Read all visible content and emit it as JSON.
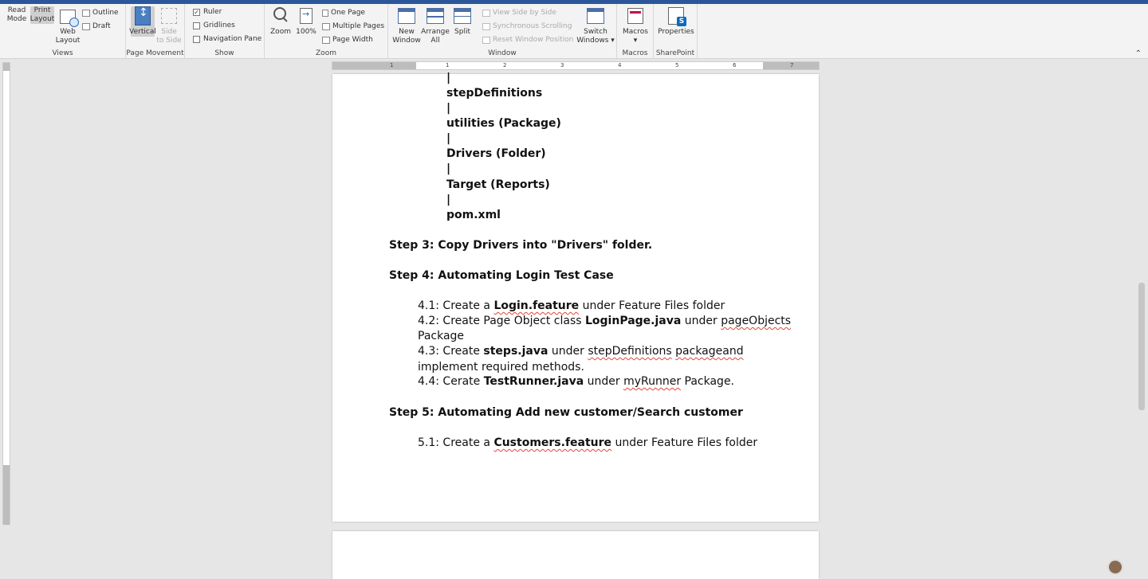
{
  "ribbon": {
    "views": {
      "label": "Views",
      "read_mode": "Read\nMode",
      "print_layout": "Print\nLayout",
      "web_layout": "Web\nLayout",
      "outline": "Outline",
      "draft": "Draft"
    },
    "page_movement": {
      "label": "Page Movement",
      "vertical": "Vertical",
      "side_to_side": "Side\nto Side"
    },
    "show": {
      "label": "Show",
      "ruler": "Ruler",
      "gridlines": "Gridlines",
      "navigation_pane": "Navigation Pane"
    },
    "zoom": {
      "label": "Zoom",
      "zoom": "Zoom",
      "hundred": "100%",
      "one_page": "One Page",
      "multiple_pages": "Multiple Pages",
      "page_width": "Page Width"
    },
    "window": {
      "label": "Window",
      "new_window": "New\nWindow",
      "arrange_all": "Arrange\nAll",
      "split": "Split",
      "view_side_by_side": "View Side by Side",
      "synchronous_scrolling": "Synchronous Scrolling",
      "reset_window_position": "Reset Window Position",
      "switch_windows": "Switch\nWindows ▾"
    },
    "macros": {
      "label": "Macros",
      "macros": "Macros\n▾"
    },
    "sharepoint": {
      "label": "SharePoint",
      "properties": "Properties"
    }
  },
  "ruler_ticks": [
    "1",
    "1",
    "2",
    "3",
    "4",
    "5",
    "6",
    "7"
  ],
  "document": {
    "tree": [
      "|",
      "stepDefinitions",
      "|",
      "utilities (Package)",
      "|",
      "Drivers (Folder)",
      "|",
      "Target (Reports)",
      "|",
      "pom.xml"
    ],
    "step3": "Step 3: Copy Drivers into \"Drivers\" folder.",
    "step4": "Step 4: Automating Login Test Case",
    "s41": {
      "a": "4.1: Create a ",
      "b": "Login.feature",
      "c": " under Feature Files folder"
    },
    "s42": {
      "a": "4.2:  Create Page Object class ",
      "b": "LoginPage.java",
      "c": " under ",
      "d": "pageObjects",
      "e": "Package"
    },
    "s43": {
      "a": "4.3:  Create ",
      "b": "steps.java",
      "c": " under ",
      "d": "stepDefinitions",
      "e": " ",
      "f": "packageand",
      "g": "implement required methods."
    },
    "s44": {
      "a": "4.4:  Cerate ",
      "b": "TestRunner.java",
      "c": " under ",
      "d": "myRunner",
      "e": " Package."
    },
    "step5": "Step 5: Automating Add new customer/Search customer",
    "s51": {
      "a": "5.1: Create a ",
      "b": "Customers.feature",
      "c": " under Feature Files folder"
    }
  }
}
